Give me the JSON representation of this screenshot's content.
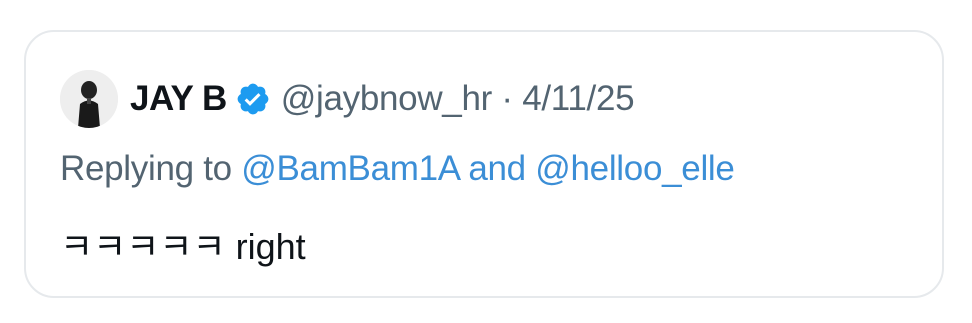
{
  "tweet": {
    "author_name": "JAY B",
    "handle": "@jaybnow_hr",
    "separator": "·",
    "date": "4/11/25",
    "replying_prefix": "Replying to",
    "replying_to_1": "@BamBam1A",
    "replying_conjunction": "and",
    "replying_to_2": "@helloo_elle",
    "text": "ㅋㅋㅋㅋㅋ right",
    "avatar_icon": "user-avatar",
    "verified_icon": "verified-badge-icon"
  },
  "colors": {
    "text_primary": "#0f1419",
    "text_secondary": "#536471",
    "mention": "#3b8ed6",
    "verified": "#1d9bf0",
    "card_border": "#e6e9ec"
  }
}
